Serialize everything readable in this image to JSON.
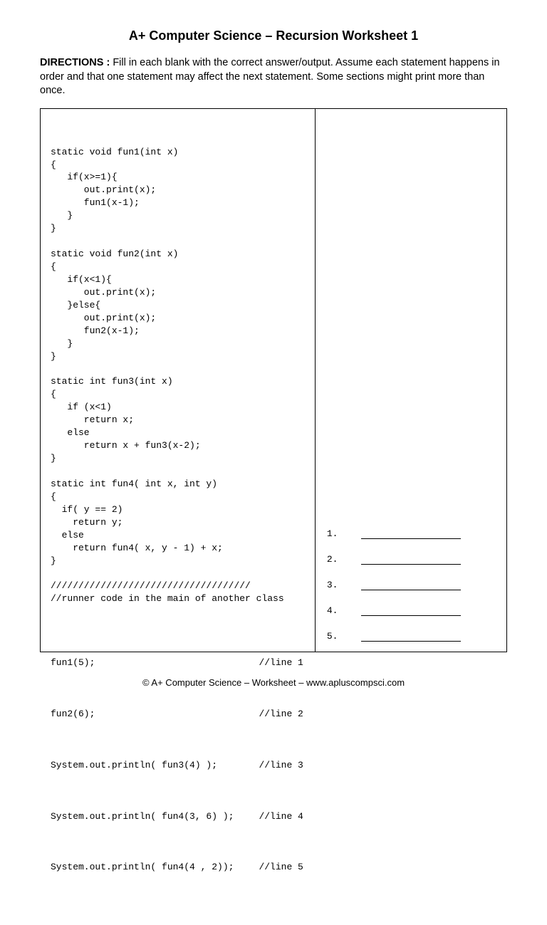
{
  "title": "A+ Computer Science –  Recursion Worksheet 1",
  "directions_label": "DIRECTIONS : ",
  "directions_text": " Fill in each blank with the correct answer/output.  Assume each statement happens in order and that one statement may affect the next statement.  Some sections might print more than once.",
  "code": "static void fun1(int x)\n{\n   if(x>=1){\n      out.print(x);\n      fun1(x-1);\n   }\n}\n\nstatic void fun2(int x)\n{\n   if(x<1){\n      out.print(x);\n   }else{\n      out.print(x);\n      fun2(x-1);\n   }\n}\n\nstatic int fun3(int x)\n{\n   if (x<1)\n      return x;\n   else\n      return x + fun3(x-2);\n}\n\nstatic int fun4( int x, int y)\n{\n  if( y == 2)\n    return y;\n  else\n    return fun4( x, y - 1) + x;\n}\n\n////////////////////////////////////\n//runner code in the main of another class\n",
  "runner": [
    {
      "call": "fun1(5);",
      "comment": "//line 1"
    },
    {
      "call": "fun2(6);",
      "comment": "//line 2"
    },
    {
      "call": "System.out.println( fun3(4) );",
      "comment": "//line 3"
    },
    {
      "call": "System.out.println( fun4(3, 6) );",
      "comment": "//line 4"
    },
    {
      "call": "System.out.println( fun4(4 , 2));",
      "comment": "//line 5"
    }
  ],
  "answers": [
    {
      "num": "1."
    },
    {
      "num": "2."
    },
    {
      "num": "3."
    },
    {
      "num": "4."
    },
    {
      "num": "5."
    }
  ],
  "footer": "© A+ Computer Science – Worksheet – www.apluscompsci.com"
}
